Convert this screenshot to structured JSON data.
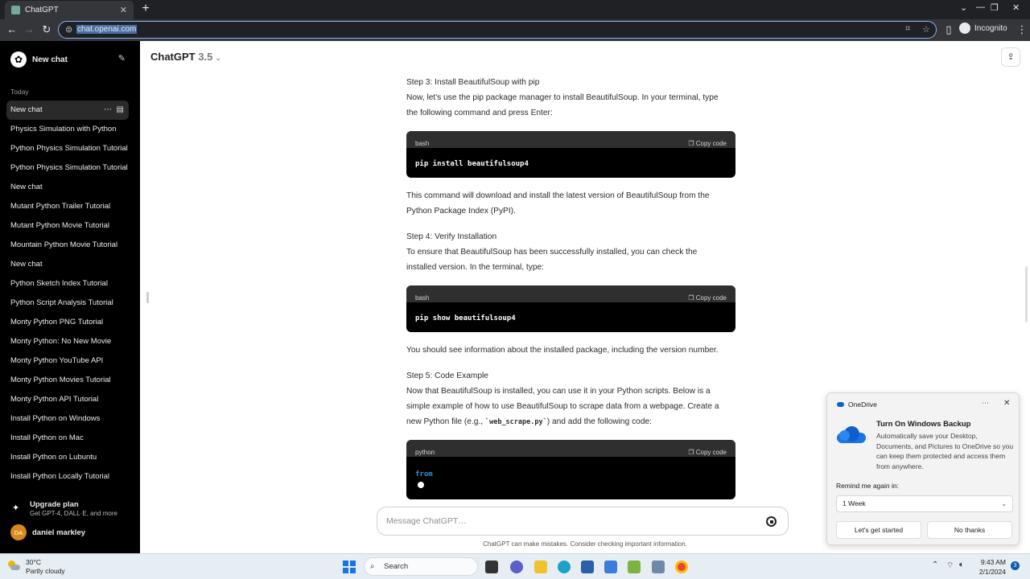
{
  "browser": {
    "tab_title": "ChatGPT",
    "url": "chat.openai.com",
    "profile_label": "Incognito",
    "new_tab_icon": "+",
    "tab_close_icon": "✕"
  },
  "sidebar": {
    "new_chat_label": "New chat",
    "section_label": "Today",
    "chats": [
      "New chat",
      "Physics Simulation with Python",
      "Python Physics Simulation Tutorial",
      "Python Physics Simulation Tutorial",
      "New chat",
      "Mutant Python Trailer Tutorial",
      "Mutant Python Movie Tutorial",
      "Mountain Python Movie Tutorial",
      "New chat",
      "Python Sketch Index Tutorial",
      "Python Script Analysis Tutorial",
      "Monty Python PNG Tutorial",
      "Monty Python: No New Movie",
      "Monty Python YouTube API",
      "Monty Python Movies Tutorial",
      "Monty Python API Tutorial",
      "Install Python on Windows",
      "Install Python on Mac",
      "Install Python on Lubuntu",
      "Install Python Locally Tutorial"
    ],
    "upgrade_title": "Upgrade plan",
    "upgrade_sub": "Get GPT-4, DALL·E, and more",
    "user_initials": "DA",
    "user_name": "daniel markley"
  },
  "header": {
    "model_name": "ChatGPT",
    "model_version": "3.5"
  },
  "conversation": {
    "step3_title": "Step 3: Install BeautifulSoup with pip",
    "step3_l1": "Now, let's use the pip package manager to install BeautifulSoup. In your terminal, type",
    "step3_l2": "the following command and press Enter:",
    "code1_lang": "bash",
    "code1_text": "pip install beautifulsoup4",
    "after1_l1": "This command will download and install the latest version of BeautifulSoup from the",
    "after1_l2": "Python Package Index (PyPI).",
    "step4_title": "Step 4: Verify Installation",
    "step4_l1": "To ensure that BeautifulSoup has been successfully installed, you can check the",
    "step4_l2": "installed version. In the terminal, type:",
    "code2_lang": "bash",
    "code2_text": "pip show beautifulsoup4",
    "after2_l1": "You should see information about the installed package, including the version number.",
    "step5_title": "Step 5: Code Example",
    "step5_l1": "Now that BeautifulSoup is installed, you can use it in your Python scripts. Below is a",
    "step5_l2": "simple example of how to use BeautifulSoup to scrape data from a webpage. Create a",
    "step5_l3_pre": "new Python file (e.g., ",
    "step5_l3_code": "`web_scrape.py`",
    "step5_l3_post": ") and add the following code:",
    "code3_lang": "python",
    "code3_text": "from",
    "copy_label": "Copy code"
  },
  "composer": {
    "placeholder": "Message ChatGPT…",
    "disclaimer": "ChatGPT can make mistakes. Consider checking important information."
  },
  "onedrive": {
    "app": "OneDrive",
    "title": "Turn On Windows Backup",
    "body": "Automatically save your Desktop, Documents, and Pictures to OneDrive so you can keep them protected and access them from anywhere.",
    "remind_label": "Remind me again in:",
    "remind_value": "1 Week",
    "primary": "Let's get started",
    "secondary": "No thanks"
  },
  "taskbar": {
    "temp": "30°C",
    "weather": "Partly cloudy",
    "search": "Search",
    "time": "9:43 AM",
    "date": "2/1/2024",
    "notifications": "3"
  }
}
